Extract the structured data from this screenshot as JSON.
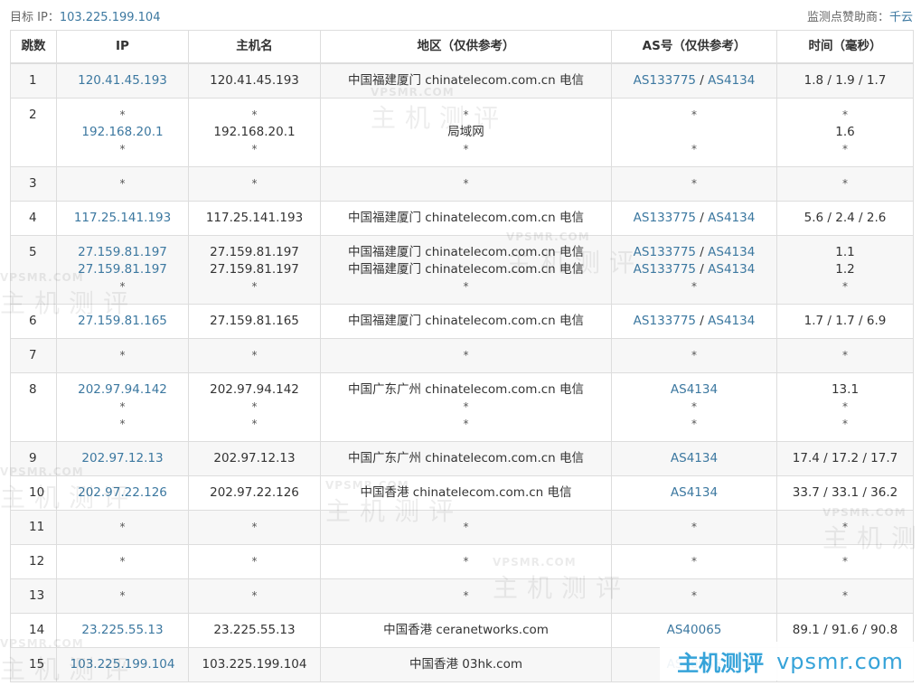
{
  "header": {
    "target_label": "目标 IP：",
    "target_ip": "103.225.199.104",
    "sponsor_label": "监测点赞助商：",
    "sponsor_name": "千云"
  },
  "table": {
    "columns": [
      "跳数",
      "IP",
      "主机名",
      "地区（仅供参考）",
      "AS号（仅供参考）",
      "时间（毫秒）"
    ],
    "rows": [
      {
        "hop": "1",
        "ip": [
          "120.41.45.193"
        ],
        "host": [
          "120.41.45.193"
        ],
        "region": [
          "中国福建厦门 chinatelecom.com.cn 电信"
        ],
        "as": [
          [
            "AS133775",
            "AS4134"
          ]
        ],
        "time": [
          "1.8 / 1.9 / 1.7"
        ]
      },
      {
        "hop": "2",
        "ip": [
          "*",
          "192.168.20.1",
          "*"
        ],
        "host": [
          "*",
          "192.168.20.1",
          "*"
        ],
        "region": [
          "*",
          "局域网",
          "*"
        ],
        "as": [
          [
            "*"
          ],
          [
            ""
          ],
          [
            "*"
          ]
        ],
        "time": [
          "*",
          "1.6",
          "*"
        ]
      },
      {
        "hop": "3",
        "ip": [
          "*"
        ],
        "host": [
          "*"
        ],
        "region": [
          "*"
        ],
        "as": [
          [
            "*"
          ]
        ],
        "time": [
          "*"
        ]
      },
      {
        "hop": "4",
        "ip": [
          "117.25.141.193"
        ],
        "host": [
          "117.25.141.193"
        ],
        "region": [
          "中国福建厦门 chinatelecom.com.cn 电信"
        ],
        "as": [
          [
            "AS133775",
            "AS4134"
          ]
        ],
        "time": [
          "5.6 / 2.4 / 2.6"
        ]
      },
      {
        "hop": "5",
        "ip": [
          "27.159.81.197",
          "27.159.81.197",
          "*"
        ],
        "host": [
          "27.159.81.197",
          "27.159.81.197",
          "*"
        ],
        "region": [
          "中国福建厦门 chinatelecom.com.cn 电信",
          "中国福建厦门 chinatelecom.com.cn 电信",
          "*"
        ],
        "as": [
          [
            "AS133775",
            "AS4134"
          ],
          [
            "AS133775",
            "AS4134"
          ],
          [
            "*"
          ]
        ],
        "time": [
          "1.1",
          "1.2",
          "*"
        ]
      },
      {
        "hop": "6",
        "ip": [
          "27.159.81.165"
        ],
        "host": [
          "27.159.81.165"
        ],
        "region": [
          "中国福建厦门 chinatelecom.com.cn 电信"
        ],
        "as": [
          [
            "AS133775",
            "AS4134"
          ]
        ],
        "time": [
          "1.7 / 1.7 / 6.9"
        ]
      },
      {
        "hop": "7",
        "ip": [
          "*"
        ],
        "host": [
          "*"
        ],
        "region": [
          "*"
        ],
        "as": [
          [
            "*"
          ]
        ],
        "time": [
          "*"
        ]
      },
      {
        "hop": "8",
        "ip": [
          "202.97.94.142",
          "*",
          "*"
        ],
        "host": [
          "202.97.94.142",
          "*",
          "*"
        ],
        "region": [
          "中国广东广州 chinatelecom.com.cn 电信",
          "*",
          "*"
        ],
        "as": [
          [
            "AS4134"
          ],
          [
            "*"
          ],
          [
            "*"
          ]
        ],
        "time": [
          "13.1",
          "*",
          "*"
        ]
      },
      {
        "hop": "9",
        "ip": [
          "202.97.12.13"
        ],
        "host": [
          "202.97.12.13"
        ],
        "region": [
          "中国广东广州 chinatelecom.com.cn 电信"
        ],
        "as": [
          [
            "AS4134"
          ]
        ],
        "time": [
          "17.4 / 17.2 / 17.7"
        ]
      },
      {
        "hop": "10",
        "ip": [
          "202.97.22.126"
        ],
        "host": [
          "202.97.22.126"
        ],
        "region": [
          "中国香港 chinatelecom.com.cn 电信"
        ],
        "as": [
          [
            "AS4134"
          ]
        ],
        "time": [
          "33.7 / 33.1 / 36.2"
        ]
      },
      {
        "hop": "11",
        "ip": [
          "*"
        ],
        "host": [
          "*"
        ],
        "region": [
          "*"
        ],
        "as": [
          [
            "*"
          ]
        ],
        "time": [
          "*"
        ]
      },
      {
        "hop": "12",
        "ip": [
          "*"
        ],
        "host": [
          "*"
        ],
        "region": [
          "*"
        ],
        "as": [
          [
            "*"
          ]
        ],
        "time": [
          "*"
        ]
      },
      {
        "hop": "13",
        "ip": [
          "*"
        ],
        "host": [
          "*"
        ],
        "region": [
          "*"
        ],
        "as": [
          [
            "*"
          ]
        ],
        "time": [
          "*"
        ]
      },
      {
        "hop": "14",
        "ip": [
          "23.225.55.13"
        ],
        "host": [
          "23.225.55.13"
        ],
        "region": [
          "中国香港 ceranetworks.com"
        ],
        "as": [
          [
            "AS40065"
          ]
        ],
        "time": [
          "89.1 / 91.6 / 90.8"
        ]
      },
      {
        "hop": "15",
        "ip": [
          "103.225.199.104"
        ],
        "host": [
          "103.225.199.104"
        ],
        "region": [
          "中国香港 03hk.com"
        ],
        "as": [
          [
            "AS40065"
          ]
        ],
        "time": [
          ""
        ]
      }
    ]
  },
  "watermark": {
    "text": "主机测评",
    "domain_small": "VPSMR.COM",
    "brand_text": "主机测评",
    "brand_domain": "vpsmr.com"
  },
  "colors": {
    "link": "#3c78a0",
    "brand": "#36a3d9",
    "alt_row": "#f7f7f7",
    "border": "#dddddd"
  }
}
